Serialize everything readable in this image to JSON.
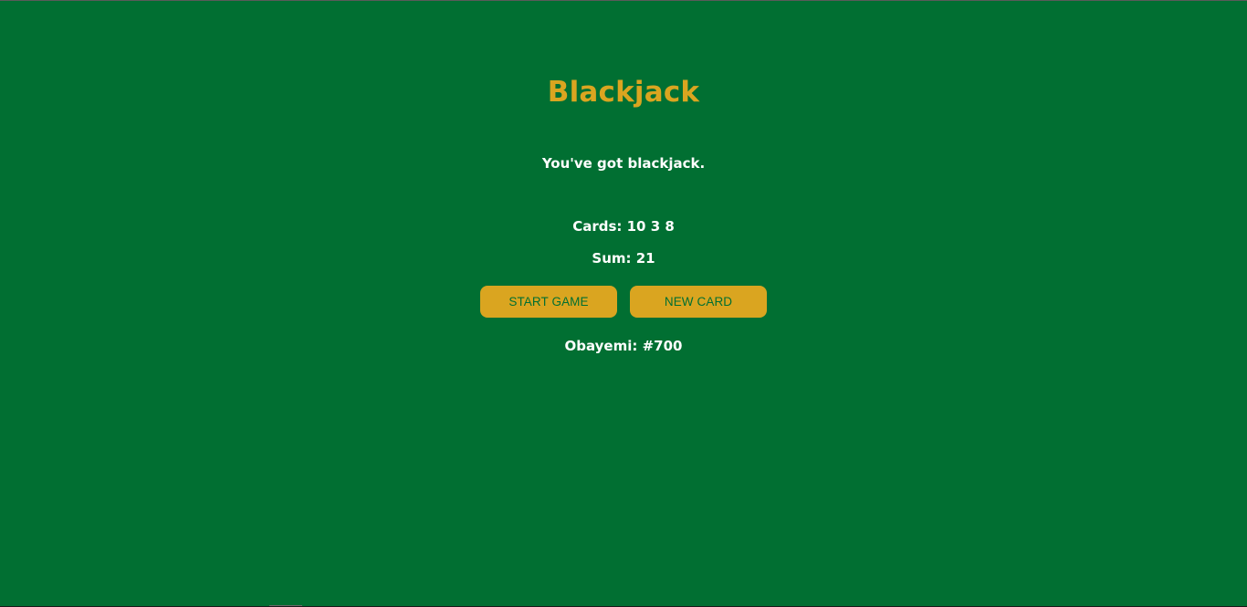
{
  "title": "Blackjack",
  "message": "You've got blackjack.",
  "cards_text": "Cards: 10 3 8",
  "sum_text": "Sum: 21",
  "buttons": {
    "start": "START GAME",
    "new_card": "NEW CARD"
  },
  "player_text": "Obayemi: #700",
  "colors": {
    "background": "#016f32",
    "accent": "#daa520",
    "text": "#ffffff"
  }
}
